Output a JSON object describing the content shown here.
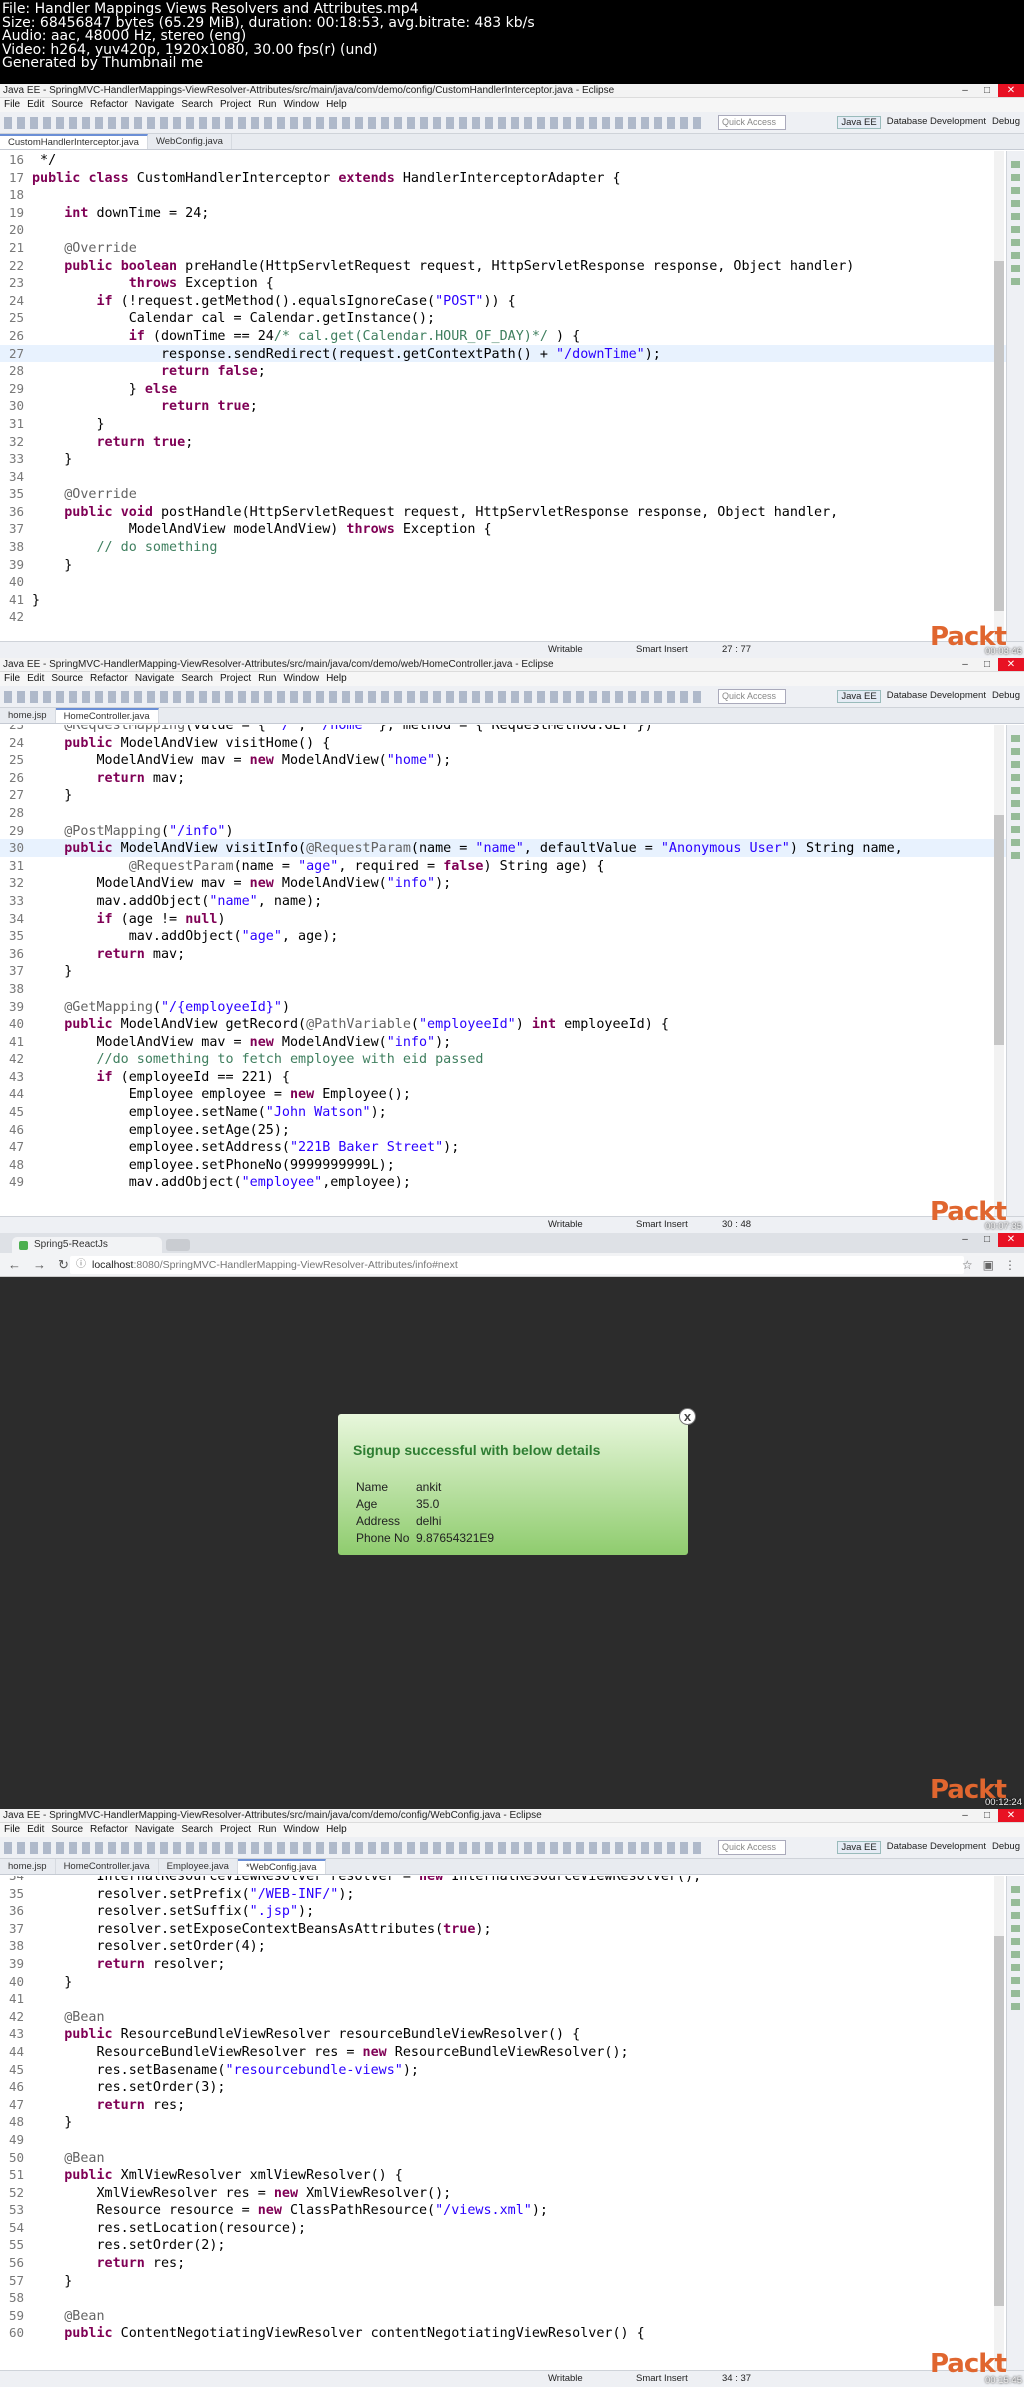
{
  "info": {
    "lines": [
      "File: Handler Mappings Views Resolvers and Attributes.mp4",
      "Size: 68456847 bytes (65.29 MiB), duration: 00:18:53, avg.bitrate: 483 kb/s",
      "Audio: aac, 48000 Hz, stereo (eng)",
      "Video: h264, yuv420p, 1920x1080, 30.00 fps(r) (und)",
      "Generated by Thumbnail me"
    ]
  },
  "menu": [
    "File",
    "Edit",
    "Source",
    "Refactor",
    "Navigate",
    "Search",
    "Project",
    "Run",
    "Window",
    "Help"
  ],
  "quick_access": "Quick Access",
  "perspectives": [
    "Java EE",
    "Database Development",
    "Debug"
  ],
  "brand": "Packt",
  "frame1": {
    "title": "Java EE - SpringMVC-HandlerMappings-ViewResolver-Attributes/src/main/java/com/demo/config/CustomHandlerInterceptor.java - Eclipse",
    "tabs": [
      "CustomHandlerInterceptor.java",
      "WebConfig.java"
    ],
    "status": {
      "writable": "Writable",
      "insert": "Smart Insert",
      "pos": "27 : 77"
    },
    "timestamp": "00:03:46",
    "lines": [
      [
        "16",
        " */"
      ],
      [
        "17",
        "public class CustomHandlerInterceptor extends HandlerInterceptorAdapter {"
      ],
      [
        "18",
        ""
      ],
      [
        "19",
        "    int downTime = 24;"
      ],
      [
        "20",
        ""
      ],
      [
        "21",
        "    @Override"
      ],
      [
        "22",
        "    public boolean preHandle(HttpServletRequest request, HttpServletResponse response, Object handler)"
      ],
      [
        "23",
        "            throws Exception {"
      ],
      [
        "24",
        "        if (!request.getMethod().equalsIgnoreCase(\"POST\")) {"
      ],
      [
        "25",
        "            Calendar cal = Calendar.getInstance();"
      ],
      [
        "26",
        "            if (downTime == 24/* cal.get(Calendar.HOUR_OF_DAY)*/ ) {"
      ],
      [
        "27",
        "                response.sendRedirect(request.getContextPath() + \"/downTime\");"
      ],
      [
        "28",
        "                return false;"
      ],
      [
        "29",
        "            } else"
      ],
      [
        "30",
        "                return true;"
      ],
      [
        "31",
        "        }"
      ],
      [
        "32",
        "        return true;"
      ],
      [
        "33",
        "    }"
      ],
      [
        "34",
        ""
      ],
      [
        "35",
        "    @Override"
      ],
      [
        "36",
        "    public void postHandle(HttpServletRequest request, HttpServletResponse response, Object handler,"
      ],
      [
        "37",
        "            ModelAndView modelAndView) throws Exception {"
      ],
      [
        "38",
        "        // do something"
      ],
      [
        "39",
        "    }"
      ],
      [
        "40",
        ""
      ],
      [
        "41",
        "}"
      ],
      [
        "42",
        ""
      ]
    ]
  },
  "frame2": {
    "title": "Java EE - SpringMVC-HandlerMapping-ViewResolver-Attributes/src/main/java/com/demo/web/HomeController.java - Eclipse",
    "tabs": [
      "home.jsp",
      "HomeController.java"
    ],
    "status": {
      "writable": "Writable",
      "insert": "Smart Insert",
      "pos": "30 : 48"
    },
    "timestamp": "00:07:35",
    "lines": [
      [
        "23",
        "    @RequestMapping(value = { \"/\", \"/home\" }, method = { RequestMethod.GET })"
      ],
      [
        "24",
        "    public ModelAndView visitHome() {"
      ],
      [
        "25",
        "        ModelAndView mav = new ModelAndView(\"home\");"
      ],
      [
        "26",
        "        return mav;"
      ],
      [
        "27",
        "    }"
      ],
      [
        "28",
        ""
      ],
      [
        "29",
        "    @PostMapping(\"/info\")"
      ],
      [
        "30",
        "    public ModelAndView visitInfo(@RequestParam(name = \"name\", defaultValue = \"Anonymous User\") String name,"
      ],
      [
        "31",
        "            @RequestParam(name = \"age\", required = false) String age) {"
      ],
      [
        "32",
        "        ModelAndView mav = new ModelAndView(\"info\");"
      ],
      [
        "33",
        "        mav.addObject(\"name\", name);"
      ],
      [
        "34",
        "        if (age != null)"
      ],
      [
        "35",
        "            mav.addObject(\"age\", age);"
      ],
      [
        "36",
        "        return mav;"
      ],
      [
        "37",
        "    }"
      ],
      [
        "38",
        ""
      ],
      [
        "39",
        "    @GetMapping(\"/{employeeId}\")"
      ],
      [
        "40",
        "    public ModelAndView getRecord(@PathVariable(\"employeeId\") int employeeId) {"
      ],
      [
        "41",
        "        ModelAndView mav = new ModelAndView(\"info\");"
      ],
      [
        "42",
        "        //do something to fetch employee with eid passed"
      ],
      [
        "43",
        "        if (employeeId == 221) {"
      ],
      [
        "44",
        "            Employee employee = new Employee();"
      ],
      [
        "45",
        "            employee.setName(\"John Watson\");"
      ],
      [
        "46",
        "            employee.setAge(25);"
      ],
      [
        "47",
        "            employee.setAddress(\"221B Baker Street\");"
      ],
      [
        "48",
        "            employee.setPhoneNo(9999999999L);"
      ],
      [
        "49",
        "            mav.addObject(\"employee\",employee);"
      ]
    ]
  },
  "frame3": {
    "tab": "Spring5-ReactJs",
    "url_host": "localhost",
    "url_path": ":8080/SpringMVC-HandlerMapping-ViewResolver-Attributes/info#next",
    "modal_title": "Signup successful with below details",
    "close": "x",
    "rows": [
      [
        "Name",
        "ankit"
      ],
      [
        "Age",
        "35.0"
      ],
      [
        "Address",
        "delhi"
      ],
      [
        "Phone No",
        "9.87654321E9"
      ]
    ],
    "timestamp": "00:12:24"
  },
  "frame4": {
    "title": "Java EE - SpringMVC-HandlerMapping-ViewResolver-Attributes/src/main/java/com/demo/config/WebConfig.java - Eclipse",
    "tabs": [
      "home.jsp",
      "HomeController.java",
      "Employee.java",
      "*WebConfig.java"
    ],
    "status": {
      "writable": "Writable",
      "insert": "Smart Insert",
      "pos": "34 : 37"
    },
    "timestamp": "00:15:45",
    "lines": [
      [
        "34",
        "        InternalResourceViewResolver resolver = new InternalResourceViewResolver();"
      ],
      [
        "35",
        "        resolver.setPrefix(\"/WEB-INF/\");"
      ],
      [
        "36",
        "        resolver.setSuffix(\".jsp\");"
      ],
      [
        "37",
        "        resolver.setExposeContextBeansAsAttributes(true);"
      ],
      [
        "38",
        "        resolver.setOrder(4);"
      ],
      [
        "39",
        "        return resolver;"
      ],
      [
        "40",
        "    }"
      ],
      [
        "41",
        ""
      ],
      [
        "42",
        "    @Bean"
      ],
      [
        "43",
        "    public ResourceBundleViewResolver resourceBundleViewResolver() {"
      ],
      [
        "44",
        "        ResourceBundleViewResolver res = new ResourceBundleViewResolver();"
      ],
      [
        "45",
        "        res.setBasename(\"resourcebundle-views\");"
      ],
      [
        "46",
        "        res.setOrder(3);"
      ],
      [
        "47",
        "        return res;"
      ],
      [
        "48",
        "    }"
      ],
      [
        "49",
        ""
      ],
      [
        "50",
        "    @Bean"
      ],
      [
        "51",
        "    public XmlViewResolver xmlViewResolver() {"
      ],
      [
        "52",
        "        XmlViewResolver res = new XmlViewResolver();"
      ],
      [
        "53",
        "        Resource resource = new ClassPathResource(\"/views.xml\");"
      ],
      [
        "54",
        "        res.setLocation(resource);"
      ],
      [
        "55",
        "        res.setOrder(2);"
      ],
      [
        "56",
        "        return res;"
      ],
      [
        "57",
        "    }"
      ],
      [
        "58",
        ""
      ],
      [
        "59",
        "    @Bean"
      ],
      [
        "60",
        "    public ContentNegotiatingViewResolver contentNegotiatingViewResolver() {"
      ]
    ]
  }
}
